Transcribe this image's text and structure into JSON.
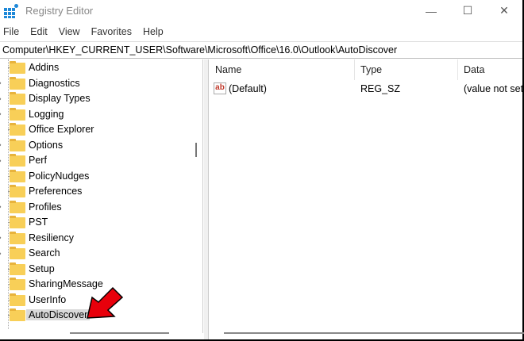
{
  "window": {
    "title": "Registry Editor",
    "minimize": "—",
    "maximize": "☐",
    "close": "✕"
  },
  "menu": [
    "File",
    "Edit",
    "View",
    "Favorites",
    "Help"
  ],
  "address": "Computer\\HKEY_CURRENT_USER\\Software\\Microsoft\\Office\\16.0\\Outlook\\AutoDiscover",
  "tree": [
    {
      "label": "Addins",
      "expandable": false
    },
    {
      "label": "Diagnostics",
      "expandable": true
    },
    {
      "label": "Display Types",
      "expandable": true
    },
    {
      "label": "Logging",
      "expandable": true
    },
    {
      "label": "Office Explorer",
      "expandable": false
    },
    {
      "label": "Options",
      "expandable": true
    },
    {
      "label": "Perf",
      "expandable": true
    },
    {
      "label": "PolicyNudges",
      "expandable": false
    },
    {
      "label": "Preferences",
      "expandable": false
    },
    {
      "label": "Profiles",
      "expandable": true
    },
    {
      "label": "PST",
      "expandable": false
    },
    {
      "label": "Resiliency",
      "expandable": true
    },
    {
      "label": "Search",
      "expandable": true
    },
    {
      "label": "Setup",
      "expandable": false
    },
    {
      "label": "SharingMessage",
      "expandable": false
    },
    {
      "label": "UserInfo",
      "expandable": false
    },
    {
      "label": "AutoDiscover",
      "expandable": false,
      "selected": true
    }
  ],
  "columns": [
    "Name",
    "Type",
    "Data"
  ],
  "values": [
    {
      "icon": "ab",
      "name": "(Default)",
      "type": "REG_SZ",
      "data": "(value not set)"
    }
  ],
  "colors": {
    "arrow": "#e8000b",
    "folder": "#f8cf58",
    "selection": "#d9d9d9"
  }
}
